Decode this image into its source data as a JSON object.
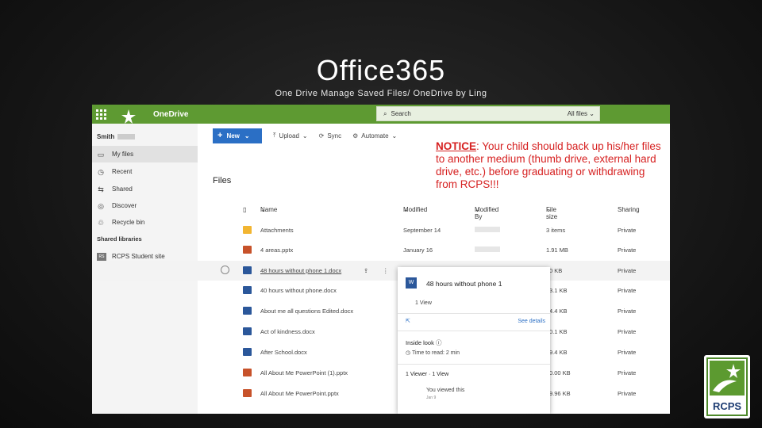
{
  "slide": {
    "title": "Office365",
    "subtitle": "One Drive Manage Saved Files/ OneDrive by  Ling"
  },
  "app": {
    "name": "OneDrive",
    "logo_text": "RCPS",
    "accent": "#5e9a32"
  },
  "sidebar": {
    "user": "Smith",
    "items": [
      {
        "label": "My files",
        "icon": "folder-icon"
      },
      {
        "label": "Recent",
        "icon": "clock-icon"
      },
      {
        "label": "Shared",
        "icon": "share-icon"
      },
      {
        "label": "Discover",
        "icon": "discover-icon"
      },
      {
        "label": "Recycle bin",
        "icon": "recycle-icon"
      }
    ],
    "shared_libraries_label": "Shared libraries",
    "library": {
      "label": "RCPS Student site",
      "icon_text": "RS"
    }
  },
  "toolbar": {
    "new_label": "New",
    "upload_label": "Upload",
    "sync_label": "Sync",
    "automate_label": "Automate"
  },
  "search": {
    "placeholder": "Search",
    "scope": "All files"
  },
  "main": {
    "heading": "Files"
  },
  "notice": {
    "heading": "NOTICE",
    "text": ": Your child should back up his/her files to another medium (thumb drive, external hard drive, etc.) before graduating or withdrawing from RCPS!!!"
  },
  "table": {
    "columns": [
      "Name",
      "Modified",
      "Modified By",
      "File size",
      "Sharing"
    ],
    "rows": [
      {
        "name": "Attachments",
        "type": "folder",
        "modified": "September 14",
        "size": "3 items",
        "sharing": "Private"
      },
      {
        "name": "4 areas.pptx",
        "type": "ppt",
        "modified": "January 16",
        "size": "1.91 MB",
        "sharing": "Private"
      },
      {
        "name": "48 hours without phone 1.docx",
        "type": "doc",
        "modified": "",
        "size": "0 KB",
        "sharing": "Private"
      },
      {
        "name": "40 hours without phone.docx",
        "type": "doc",
        "modified": "",
        "size": "3.1 KB",
        "sharing": "Private"
      },
      {
        "name": "About me all questions Edited.docx",
        "type": "doc",
        "modified": "",
        "size": "4.4 KB",
        "sharing": "Private"
      },
      {
        "name": "Act of kindness.docx",
        "type": "doc",
        "modified": "",
        "size": "0.1 KB",
        "sharing": "Private"
      },
      {
        "name": "After School.docx",
        "type": "doc",
        "modified": "",
        "size": "9.4 KB",
        "sharing": "Private"
      },
      {
        "name": "All About Me PowerPoint (1).pptx",
        "type": "ppt",
        "modified": "",
        "size": "0.00 KB",
        "sharing": "Private"
      },
      {
        "name": "All About Me PowerPoint.pptx",
        "type": "ppt",
        "modified": "",
        "size": "9.96 KB",
        "sharing": "Private"
      }
    ]
  },
  "popup": {
    "title": "48 hours without phone 1",
    "views": "1 View",
    "see_details": "See details",
    "inside_look": "Inside look",
    "time_to_read": "Time to read: 2 min",
    "viewers": "1 Viewer · 1 View",
    "you_viewed": "You viewed this",
    "when": "Jan 9"
  }
}
